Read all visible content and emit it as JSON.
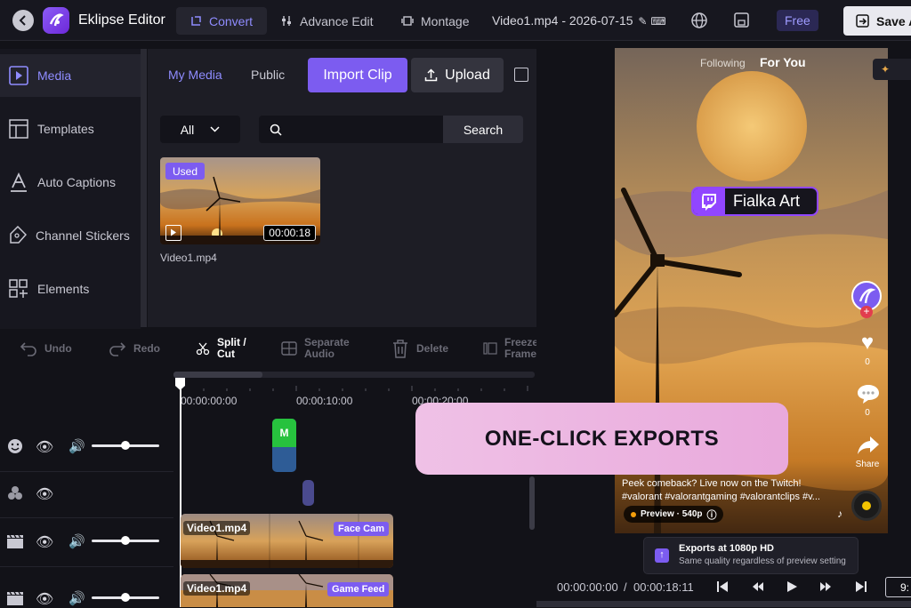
{
  "header": {
    "app_name": "Eklipse Editor",
    "tabs": [
      {
        "label": "Convert",
        "active": true
      },
      {
        "label": "Advance Edit",
        "active": false
      },
      {
        "label": "Montage",
        "active": false
      }
    ],
    "file_name": "Video1.mp4 - 2026-07-15",
    "plan_badge": "Free",
    "save_label": "Save A"
  },
  "sidebar": {
    "items": [
      {
        "label": "Media",
        "icon": "media-play-icon",
        "active": true
      },
      {
        "label": "Templates",
        "icon": "templates-icon",
        "active": false
      },
      {
        "label": "Auto Captions",
        "icon": "captions-icon",
        "active": false
      },
      {
        "label": "Channel Stickers",
        "icon": "sticker-icon",
        "active": false
      },
      {
        "label": "Elements",
        "icon": "elements-icon",
        "active": false
      }
    ]
  },
  "media_panel": {
    "tabs": [
      {
        "label": "My Media",
        "active": true
      },
      {
        "label": "Public",
        "active": false
      }
    ],
    "import_label": "Import Clip",
    "upload_label": "Upload",
    "filter_value": "All",
    "search_placeholder": "",
    "search_button": "Search",
    "clips": [
      {
        "name": "Video1.mp4",
        "duration": "00:00:18",
        "badge": "Used"
      }
    ]
  },
  "toolbar": {
    "undo": "Undo",
    "redo": "Redo",
    "split": "Split / Cut",
    "separate_audio": "Separate Audio",
    "delete": "Delete",
    "freeze": "Freeze Frame"
  },
  "timeline": {
    "ticks": [
      "00:00:00:00",
      "00:00:10:00",
      "00:00:20:00"
    ],
    "tracks": [
      {
        "icon": "emoji-icon",
        "visible": true,
        "volume": 0.5
      },
      {
        "icon": "layers-icon",
        "visible": true
      },
      {
        "icon": "clapper-icon",
        "visible": true,
        "volume": 0.5
      },
      {
        "icon": "clapper-icon",
        "visible": true,
        "volume": 0.5
      }
    ],
    "clips": [
      {
        "name": "Video1.mp4",
        "label": "Face Cam"
      },
      {
        "name": "Video1.mp4",
        "label": "Game Feed"
      }
    ],
    "small_clip_label": "M"
  },
  "preview": {
    "feed_tabs": [
      "Following",
      "For You"
    ],
    "overlay_name": "Fialka Art",
    "likes": "0",
    "comments": "0",
    "share_label": "Share",
    "caption_line1": "Peek comeback? Live now on the Twitch!",
    "caption_line2": "#valorant #valorantgaming #valorantclips #v...",
    "preview_pill": "Preview · 540p",
    "export_title": "Exports at 1080p HD",
    "export_sub": "Same quality regardless of preview setting",
    "current_time": "00:00:00:00",
    "total_time": "00:00:18:11",
    "ratio": "9:"
  },
  "promo_banner": "ONE-CLICK EXPORTS",
  "colors": {
    "accent": "#7c5cf0",
    "active_text": "#8f8cff",
    "twitch": "#9146ff"
  }
}
